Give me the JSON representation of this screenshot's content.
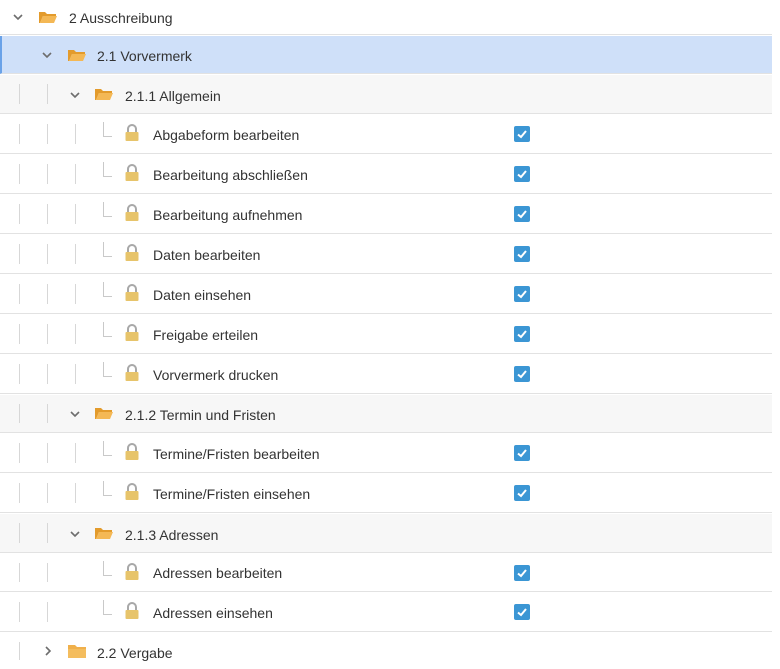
{
  "tree": {
    "root": {
      "label": "2 Ausschreibung",
      "icon": "folder-open-icon",
      "expanded": true
    },
    "sub1": {
      "label": "2.1 Vorvermerk",
      "icon": "folder-open-icon",
      "expanded": true,
      "selected": true
    },
    "groups": [
      {
        "label": "2.1.1 Allgemein",
        "icon": "folder-open-icon",
        "expanded": true,
        "items": [
          {
            "label": "Abgabeform bearbeiten",
            "checked": true
          },
          {
            "label": "Bearbeitung abschließen",
            "checked": true
          },
          {
            "label": "Bearbeitung aufnehmen",
            "checked": true
          },
          {
            "label": "Daten bearbeiten",
            "checked": true
          },
          {
            "label": "Daten einsehen",
            "checked": true
          },
          {
            "label": "Freigabe erteilen",
            "checked": true
          },
          {
            "label": "Vorvermerk drucken",
            "checked": true
          }
        ]
      },
      {
        "label": "2.1.2 Termin und Fristen",
        "icon": "folder-open-icon",
        "expanded": true,
        "items": [
          {
            "label": "Termine/Fristen bearbeiten",
            "checked": true
          },
          {
            "label": "Termine/Fristen einsehen",
            "checked": true
          }
        ]
      },
      {
        "label": "2.1.3 Adressen",
        "icon": "folder-open-icon",
        "expanded": true,
        "items": [
          {
            "label": "Adressen bearbeiten",
            "checked": true
          },
          {
            "label": "Adressen einsehen",
            "checked": true
          }
        ]
      }
    ],
    "sub2": {
      "label": "2.2 Vergabe",
      "icon": "folder-closed-icon",
      "expanded": false
    }
  },
  "colors": {
    "selected_row": "#cfe0f9",
    "selected_accent": "#6aa2e8",
    "checkbox": "#3b96d4",
    "folder": "#f0b04b",
    "lock": "#e7c46b"
  }
}
